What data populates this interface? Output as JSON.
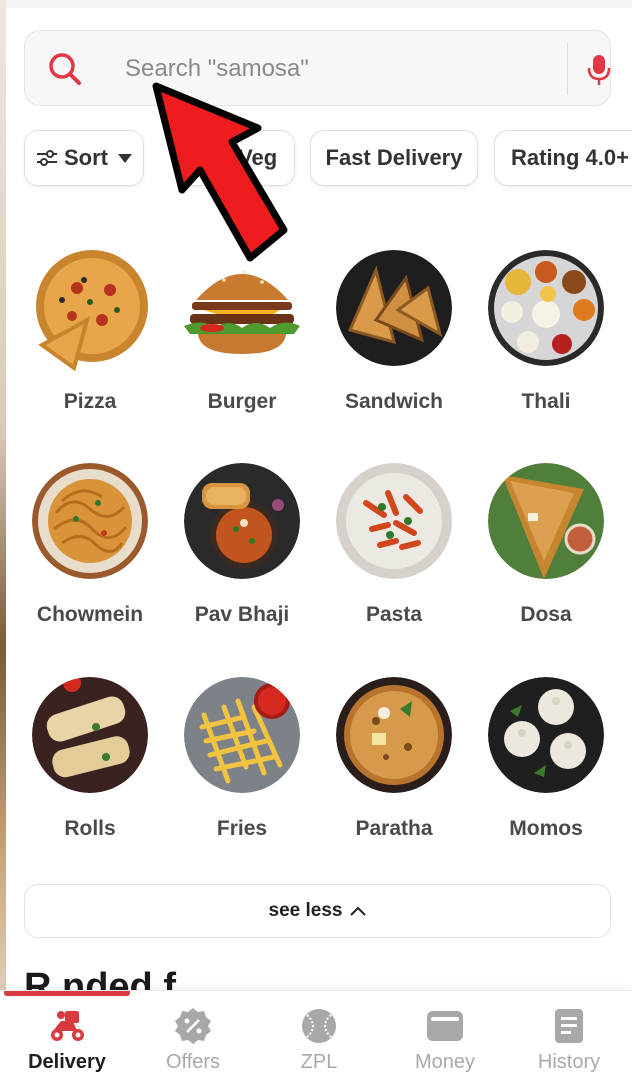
{
  "search": {
    "placeholder": "Search \"samosa\""
  },
  "filters": {
    "sort_label": "Sort",
    "veg_label": "e Veg",
    "fast_delivery_label": "Fast Delivery",
    "rating_label": "Rating 4.0+"
  },
  "categories": [
    {
      "label": "Pizza",
      "icon": "pizza-image"
    },
    {
      "label": "Burger",
      "icon": "burger-image"
    },
    {
      "label": "Sandwich",
      "icon": "sandwich-image"
    },
    {
      "label": "Thali",
      "icon": "thali-image"
    },
    {
      "label": "Chowmein",
      "icon": "chowmein-image"
    },
    {
      "label": "Pav Bhaji",
      "icon": "pav-bhaji-image"
    },
    {
      "label": "Pasta",
      "icon": "pasta-image"
    },
    {
      "label": "Dosa",
      "icon": "dosa-image"
    },
    {
      "label": "Rolls",
      "icon": "rolls-image"
    },
    {
      "label": "Fries",
      "icon": "fries-image"
    },
    {
      "label": "Paratha",
      "icon": "paratha-image"
    },
    {
      "label": "Momos",
      "icon": "momos-image"
    }
  ],
  "see_less_label": "see less",
  "partial_heading": "R        nded f",
  "nav": [
    {
      "label": "Delivery",
      "icon": "scooter-icon",
      "active": true
    },
    {
      "label": "Offers",
      "icon": "discount-badge-icon",
      "active": false
    },
    {
      "label": "ZPL",
      "icon": "cricket-ball-icon",
      "active": false
    },
    {
      "label": "Money",
      "icon": "wallet-icon",
      "active": false
    },
    {
      "label": "History",
      "icon": "history-icon",
      "active": false
    }
  ],
  "colors": {
    "accent_red": "#d83a3f",
    "text_dark": "#1e1e1e",
    "text_muted": "#a9a9a9",
    "arrow_red": "#ee1c1c"
  }
}
